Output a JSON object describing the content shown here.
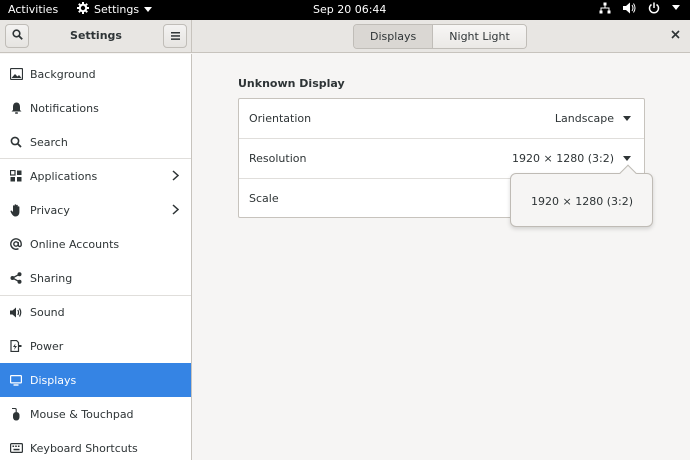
{
  "topbar": {
    "activities": "Activities",
    "app_menu": "Settings",
    "clock": "Sep 20  06:44"
  },
  "header": {
    "title": "Settings",
    "tabs": [
      {
        "label": "Displays",
        "active": true
      },
      {
        "label": "Night Light",
        "active": false
      }
    ]
  },
  "sidebar": {
    "items": [
      {
        "label": "Background",
        "icon": "background-icon"
      },
      {
        "label": "Notifications",
        "icon": "bell-icon"
      },
      {
        "label": "Search",
        "icon": "search-icon"
      },
      {
        "label": "Applications",
        "icon": "applications-grid-icon"
      },
      {
        "label": "Privacy",
        "icon": "hand-icon"
      },
      {
        "label": "Online Accounts",
        "icon": "at-sign-icon"
      },
      {
        "label": "Sharing",
        "icon": "share-icon"
      },
      {
        "label": "Sound",
        "icon": "speaker-icon"
      },
      {
        "label": "Power",
        "icon": "power-plug-icon"
      },
      {
        "label": "Displays",
        "icon": "monitor-icon",
        "selected": true
      },
      {
        "label": "Mouse & Touchpad",
        "icon": "mouse-icon"
      },
      {
        "label": "Keyboard Shortcuts",
        "icon": "keyboard-icon"
      }
    ]
  },
  "display": {
    "title": "Unknown Display",
    "rows": [
      {
        "label": "Orientation",
        "value": "Landscape"
      },
      {
        "label": "Resolution",
        "value": "1920 × 1280 (3:2)"
      },
      {
        "label": "Scale",
        "value": ""
      }
    ]
  },
  "popover": {
    "options": [
      "1920 × 1280 (3:2)"
    ]
  },
  "colors": {
    "selected": "#3584e4",
    "topbar": "#000000"
  }
}
